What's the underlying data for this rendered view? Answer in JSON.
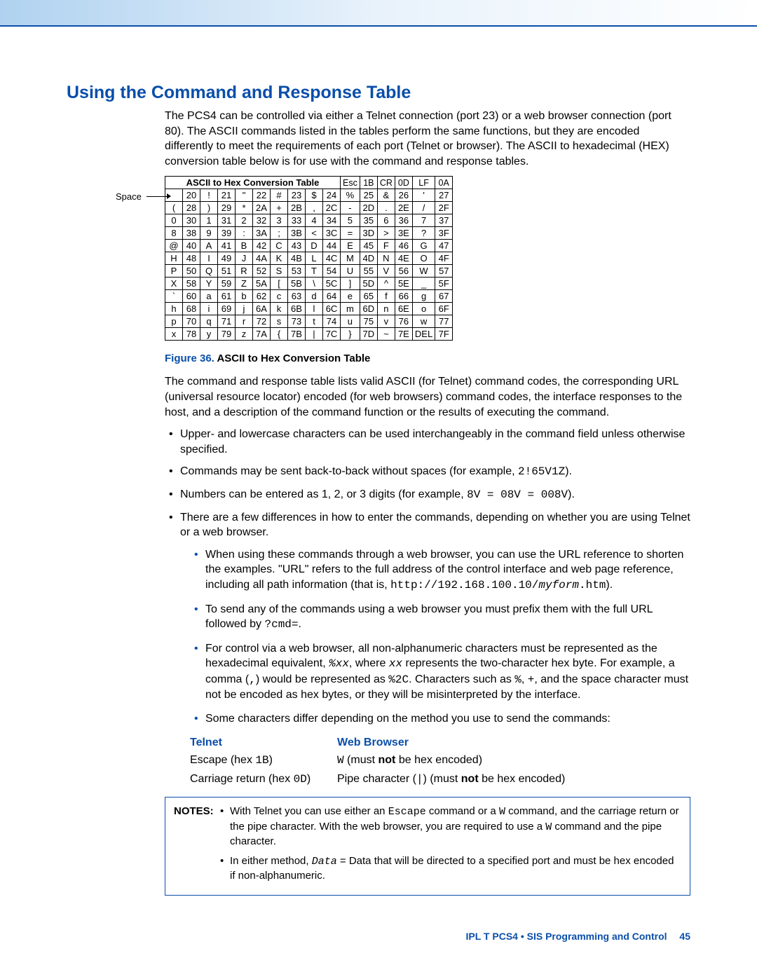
{
  "heading": "Using the Command and Response Table",
  "intro": "The PCS4 can be controlled via either a Telnet connection (port 23) or a web browser connection (port 80). The ASCII commands listed in the tables perform the same functions, but they are encoded differently to meet the requirements of each port (Telnet or browser). The ASCII to hexadecimal (HEX) conversion table below is for use with the command and response tables.",
  "space_label": "Space",
  "table_title": "ASCII to Hex Conversion Table",
  "header_pairs": [
    {
      "c": "Esc",
      "h": "1B"
    },
    {
      "c": "CR",
      "h": "0D"
    },
    {
      "c": "LF",
      "h": "0A"
    }
  ],
  "rows": [
    [
      {
        "c": " ",
        "h": "20"
      },
      {
        "c": "!",
        "h": "21"
      },
      {
        "c": "\"",
        "h": "22"
      },
      {
        "c": "#",
        "h": "23"
      },
      {
        "c": "$",
        "h": "24"
      },
      {
        "c": "%",
        "h": "25"
      },
      {
        "c": "&",
        "h": "26"
      },
      {
        "c": "'",
        "h": "27"
      }
    ],
    [
      {
        "c": "(",
        "h": "28"
      },
      {
        "c": ")",
        "h": "29"
      },
      {
        "c": "*",
        "h": "2A"
      },
      {
        "c": "+",
        "h": "2B"
      },
      {
        "c": ",",
        "h": "2C"
      },
      {
        "c": "-",
        "h": "2D"
      },
      {
        "c": ".",
        "h": "2E"
      },
      {
        "c": "/",
        "h": "2F"
      }
    ],
    [
      {
        "c": "0",
        "h": "30"
      },
      {
        "c": "1",
        "h": "31"
      },
      {
        "c": "2",
        "h": "32"
      },
      {
        "c": "3",
        "h": "33"
      },
      {
        "c": "4",
        "h": "34"
      },
      {
        "c": "5",
        "h": "35"
      },
      {
        "c": "6",
        "h": "36"
      },
      {
        "c": "7",
        "h": "37"
      }
    ],
    [
      {
        "c": "8",
        "h": "38"
      },
      {
        "c": "9",
        "h": "39"
      },
      {
        "c": ":",
        "h": "3A"
      },
      {
        "c": ";",
        "h": "3B"
      },
      {
        "c": "<",
        "h": "3C"
      },
      {
        "c": "=",
        "h": "3D"
      },
      {
        "c": ">",
        "h": "3E"
      },
      {
        "c": "?",
        "h": "3F"
      }
    ],
    [
      {
        "c": "@",
        "h": "40"
      },
      {
        "c": "A",
        "h": "41"
      },
      {
        "c": "B",
        "h": "42"
      },
      {
        "c": "C",
        "h": "43"
      },
      {
        "c": "D",
        "h": "44"
      },
      {
        "c": "E",
        "h": "45"
      },
      {
        "c": "F",
        "h": "46"
      },
      {
        "c": "G",
        "h": "47"
      }
    ],
    [
      {
        "c": "H",
        "h": "48"
      },
      {
        "c": "I",
        "h": "49"
      },
      {
        "c": "J",
        "h": "4A"
      },
      {
        "c": "K",
        "h": "4B"
      },
      {
        "c": "L",
        "h": "4C"
      },
      {
        "c": "M",
        "h": "4D"
      },
      {
        "c": "N",
        "h": "4E"
      },
      {
        "c": "O",
        "h": "4F"
      }
    ],
    [
      {
        "c": "P",
        "h": "50"
      },
      {
        "c": "Q",
        "h": "51"
      },
      {
        "c": "R",
        "h": "52"
      },
      {
        "c": "S",
        "h": "53"
      },
      {
        "c": "T",
        "h": "54"
      },
      {
        "c": "U",
        "h": "55"
      },
      {
        "c": "V",
        "h": "56"
      },
      {
        "c": "W",
        "h": "57"
      }
    ],
    [
      {
        "c": "X",
        "h": "58"
      },
      {
        "c": "Y",
        "h": "59"
      },
      {
        "c": "Z",
        "h": "5A"
      },
      {
        "c": "[",
        "h": "5B"
      },
      {
        "c": "\\",
        "h": "5C"
      },
      {
        "c": "]",
        "h": "5D"
      },
      {
        "c": "^",
        "h": "5E"
      },
      {
        "c": "_",
        "h": "5F"
      }
    ],
    [
      {
        "c": "`",
        "h": "60"
      },
      {
        "c": "a",
        "h": "61"
      },
      {
        "c": "b",
        "h": "62"
      },
      {
        "c": "c",
        "h": "63"
      },
      {
        "c": "d",
        "h": "64"
      },
      {
        "c": "e",
        "h": "65"
      },
      {
        "c": "f",
        "h": "66"
      },
      {
        "c": "g",
        "h": "67"
      }
    ],
    [
      {
        "c": "h",
        "h": "68"
      },
      {
        "c": "i",
        "h": "69"
      },
      {
        "c": "j",
        "h": "6A"
      },
      {
        "c": "k",
        "h": "6B"
      },
      {
        "c": "l",
        "h": "6C"
      },
      {
        "c": "m",
        "h": "6D"
      },
      {
        "c": "n",
        "h": "6E"
      },
      {
        "c": "o",
        "h": "6F"
      }
    ],
    [
      {
        "c": "p",
        "h": "70"
      },
      {
        "c": "q",
        "h": "71"
      },
      {
        "c": "r",
        "h": "72"
      },
      {
        "c": "s",
        "h": "73"
      },
      {
        "c": "t",
        "h": "74"
      },
      {
        "c": "u",
        "h": "75"
      },
      {
        "c": "v",
        "h": "76"
      },
      {
        "c": "w",
        "h": "77"
      }
    ],
    [
      {
        "c": "x",
        "h": "78"
      },
      {
        "c": "y",
        "h": "79"
      },
      {
        "c": "z",
        "h": "7A"
      },
      {
        "c": "{",
        "h": "7B"
      },
      {
        "c": "|",
        "h": "7C"
      },
      {
        "c": "}",
        "h": "7D"
      },
      {
        "c": "~",
        "h": "7E"
      },
      {
        "c": "DEL",
        "h": "7F"
      }
    ]
  ],
  "figure_label": "Figure 36.",
  "figure_caption": " ASCII to Hex Conversion Table",
  "body_para": "The command and response table lists valid ASCII (for Telnet) command codes, the corresponding URL (universal resource locator) encoded (for web browsers) command codes, the interface responses to the host, and a description of the command function or the results of executing the command.",
  "bullets": {
    "b1": "Upper- and lowercase characters can be used interchangeably in the command field unless otherwise specified.",
    "b2a": "Commands may be sent back-to-back without spaces (for example, ",
    "b2b": "2!65V1Z",
    "b2c": ").",
    "b3a": "Numbers can be entered as 1, 2, or 3 digits (for example, ",
    "b3b": "8V = 08V = 008V",
    "b3c": ").",
    "b4": "There are a few differences in how to enter the commands, depending on whether you are using Telnet or a web browser.",
    "s1a": "When using these commands through a web browser, you can use the URL reference to shorten the examples. \"URL\" refers to the full address of the control interface and web page reference, including all path information (that is, ",
    "s1b": "http://192.168.100.10/",
    "s1c": "myform",
    "s1d": ".htm",
    "s1e": ").",
    "s2a": "To send any of the commands using a web browser you must prefix them with the full URL followed by ",
    "s2b": "?cmd=",
    "s2c": ".",
    "s3a": "For control via a web browser, all non-alphanumeric characters must be represented as the hexadecimal equivalent, ",
    "s3b": "%xx",
    "s3c": ", where ",
    "s3d": "xx",
    "s3e": " represents the two-character hex byte. For example, a comma (",
    "s3f": ",",
    "s3g": ") would be represented as ",
    "s3h": "%2C",
    "s3i": ". Characters such as ",
    "s3j": "%",
    "s3k": ", ",
    "s3l": "+",
    "s3m": ", and the space character must not be encoded as hex bytes, or they will be misinterpreted by the interface.",
    "s4": "Some characters differ depending on the method you use to send the commands:"
  },
  "cols": {
    "h1": "Telnet",
    "h2": "Web Browser",
    "r1c1a": "Escape (hex ",
    "r1c1b": "1B",
    "r1c1c": ")",
    "r1c2a": "W",
    "r1c2b": " (must ",
    "r1c2c": "not",
    "r1c2d": " be hex encoded)",
    "r2c1a": "Carriage return (hex ",
    "r2c1b": "0D",
    "r2c1c": ")",
    "r2c2a": "Pipe character (",
    "r2c2b": "|",
    "r2c2c": ") (must ",
    "r2c2d": "not",
    "r2c2e": " be hex encoded)"
  },
  "notes": {
    "label": "NOTES:",
    "n1a": "With Telnet you can use either an ",
    "n1b": "Escape",
    "n1c": " command or a ",
    "n1d": "W",
    "n1e": " command, and the carriage return or the pipe character. With the web browser, you are required to use a ",
    "n1f": "W",
    "n1g": " command and the pipe character.",
    "n2a": "In either method, ",
    "n2b": "Data",
    "n2c": " = Data that will be directed to a specified port and must be hex encoded if non-alphanumeric."
  },
  "footer": {
    "doc": "IPL T PCS4 • SIS Programming and Control",
    "page": "45"
  }
}
